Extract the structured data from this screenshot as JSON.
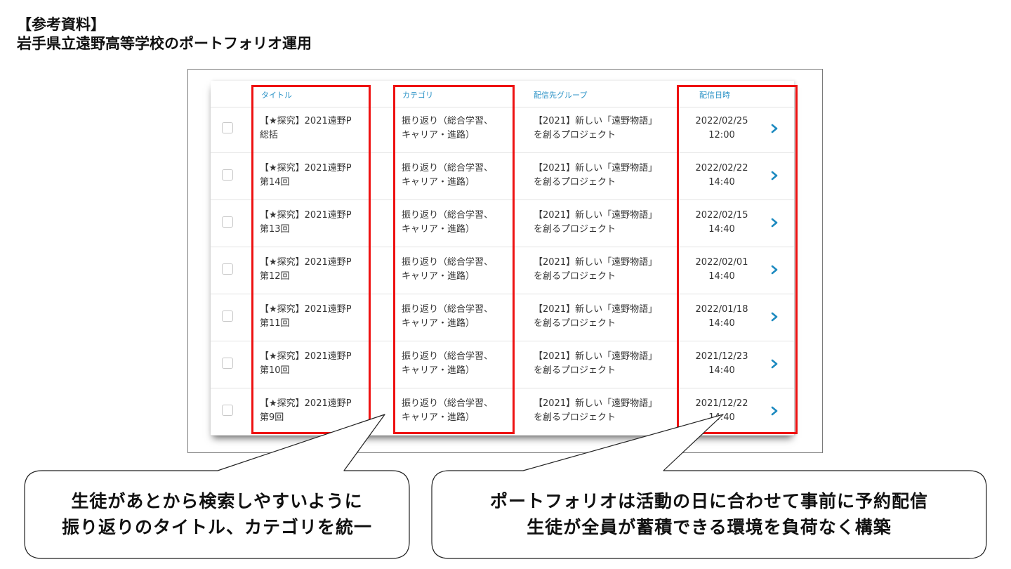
{
  "slide": {
    "title_line1": "【参考資料】",
    "title_line2": "岩手県立遠野高等学校のポートフォリオ運用"
  },
  "table": {
    "headers": {
      "title": "タイトル",
      "category": "カテゴリ",
      "group": "配信先グループ",
      "datetime": "配信日時"
    },
    "rows": [
      {
        "title1": "【★探究】2021遠野P",
        "title2": "総括",
        "cat1": "振り返り（総合学習、",
        "cat2": "キャリア・進路）",
        "grp1": "【2021】新しい「遠野物語」",
        "grp2": "を創るプロジェクト",
        "date": "2022/02/25",
        "time": "12:00"
      },
      {
        "title1": "【★探究】2021遠野P",
        "title2": "第14回",
        "cat1": "振り返り（総合学習、",
        "cat2": "キャリア・進路）",
        "grp1": "【2021】新しい「遠野物語」",
        "grp2": "を創るプロジェクト",
        "date": "2022/02/22",
        "time": "14:40"
      },
      {
        "title1": "【★探究】2021遠野P",
        "title2": "第13回",
        "cat1": "振り返り（総合学習、",
        "cat2": "キャリア・進路）",
        "grp1": "【2021】新しい「遠野物語」",
        "grp2": "を創るプロジェクト",
        "date": "2022/02/15",
        "time": "14:40"
      },
      {
        "title1": "【★探究】2021遠野P",
        "title2": "第12回",
        "cat1": "振り返り（総合学習、",
        "cat2": "キャリア・進路）",
        "grp1": "【2021】新しい「遠野物語」",
        "grp2": "を創るプロジェクト",
        "date": "2022/02/01",
        "time": "14:40"
      },
      {
        "title1": "【★探究】2021遠野P",
        "title2": "第11回",
        "cat1": "振り返り（総合学習、",
        "cat2": "キャリア・進路）",
        "grp1": "【2021】新しい「遠野物語」",
        "grp2": "を創るプロジェクト",
        "date": "2022/01/18",
        "time": "14:40"
      },
      {
        "title1": "【★探究】2021遠野P",
        "title2": "第10回",
        "cat1": "振り返り（総合学習、",
        "cat2": "キャリア・進路）",
        "grp1": "【2021】新しい「遠野物語」",
        "grp2": "を創るプロジェクト",
        "date": "2021/12/23",
        "time": "14:40"
      },
      {
        "title1": "【★探究】2021遠野P",
        "title2": "第9回",
        "cat1": "振り返り（総合学習、",
        "cat2": "キャリア・進路）",
        "grp1": "【2021】新しい「遠野物語」",
        "grp2": "を創るプロジェクト",
        "date": "2021/12/22",
        "time": "14:40"
      }
    ]
  },
  "callouts": {
    "left_line1": "生徒があとから検索しやすいように",
    "left_line2": "振り返りのタイトル、カテゴリを統一",
    "right_line1": "ポートフォリオは活動の日に合わせて事前に予約配信",
    "right_line2": "生徒が全員が蓄積できる環境を負荷なく構築"
  },
  "colors": {
    "highlight": "#ee1111",
    "header_text": "#2a92c6",
    "chevron": "#1d8ac0"
  },
  "icons": {
    "row_action": "chevron-right-icon"
  }
}
